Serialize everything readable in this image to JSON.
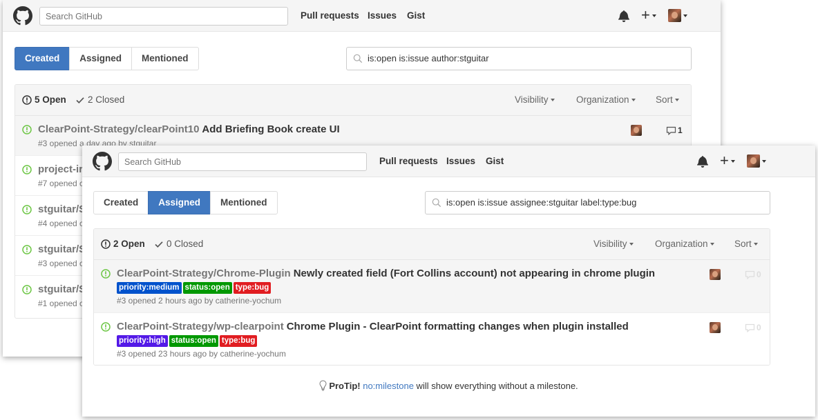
{
  "colors": {
    "accent": "#4078c0",
    "open_green": "#6cc644",
    "label_blue": "#0052cc",
    "label_green": "#009800",
    "label_red": "#e11d21",
    "label_purple": "#5319e7"
  },
  "back": {
    "search_placeholder": "Search GitHub",
    "nav": [
      "Pull requests",
      "Issues",
      "Gist"
    ],
    "tabs": [
      "Created",
      "Assigned",
      "Mentioned"
    ],
    "active_tab": "Created",
    "filter_query": "is:open is:issue author:stguitar",
    "open_count": "5 Open",
    "closed_count": "2 Closed",
    "filters": [
      "Visibility",
      "Organization",
      "Sort"
    ],
    "issues": [
      {
        "repo": "ClearPoint-Strategy/clearPoint10",
        "title": "Add Briefing Book create UI",
        "meta": "#3 opened a day ago by stguitar",
        "comments": "1"
      },
      {
        "repo": "project-ir",
        "meta": "#7 opened c"
      },
      {
        "repo": "stguitar/S",
        "meta": "#4 opened c"
      },
      {
        "repo": "stguitar/S",
        "meta": "#3 opened c"
      },
      {
        "repo": "stguitar/S",
        "meta": "#1 opened c"
      }
    ]
  },
  "front": {
    "search_placeholder": "Search GitHub",
    "nav": [
      "Pull requests",
      "Issues",
      "Gist"
    ],
    "tabs": [
      "Created",
      "Assigned",
      "Mentioned"
    ],
    "active_tab": "Assigned",
    "filter_query": "is:open is:issue assignee:stguitar label:type:bug",
    "open_count": "2 Open",
    "closed_count": "0 Closed",
    "filters": [
      "Visibility",
      "Organization",
      "Sort"
    ],
    "issues": [
      {
        "repo": "ClearPoint-Strategy/Chrome-Plugin",
        "title": "Newly created field (Fort Collins account) not appearing in chrome plugin",
        "labels": [
          "priority:medium",
          "status:open",
          "type:bug"
        ],
        "meta": "#3 opened 2 hours ago by catherine-yochum",
        "comments": "0"
      },
      {
        "repo": "ClearPoint-Strategy/wp-clearpoint",
        "title": "Chrome Plugin - ClearPoint formatting changes when plugin installed",
        "labels": [
          "priority:high",
          "status:open",
          "type:bug"
        ],
        "meta": "#3 opened 23 hours ago by catherine-yochum",
        "comments": "0"
      }
    ],
    "protip": {
      "prefix": "ProTip!",
      "link": "no:milestone",
      "suffix": " will show everything without a milestone."
    }
  }
}
